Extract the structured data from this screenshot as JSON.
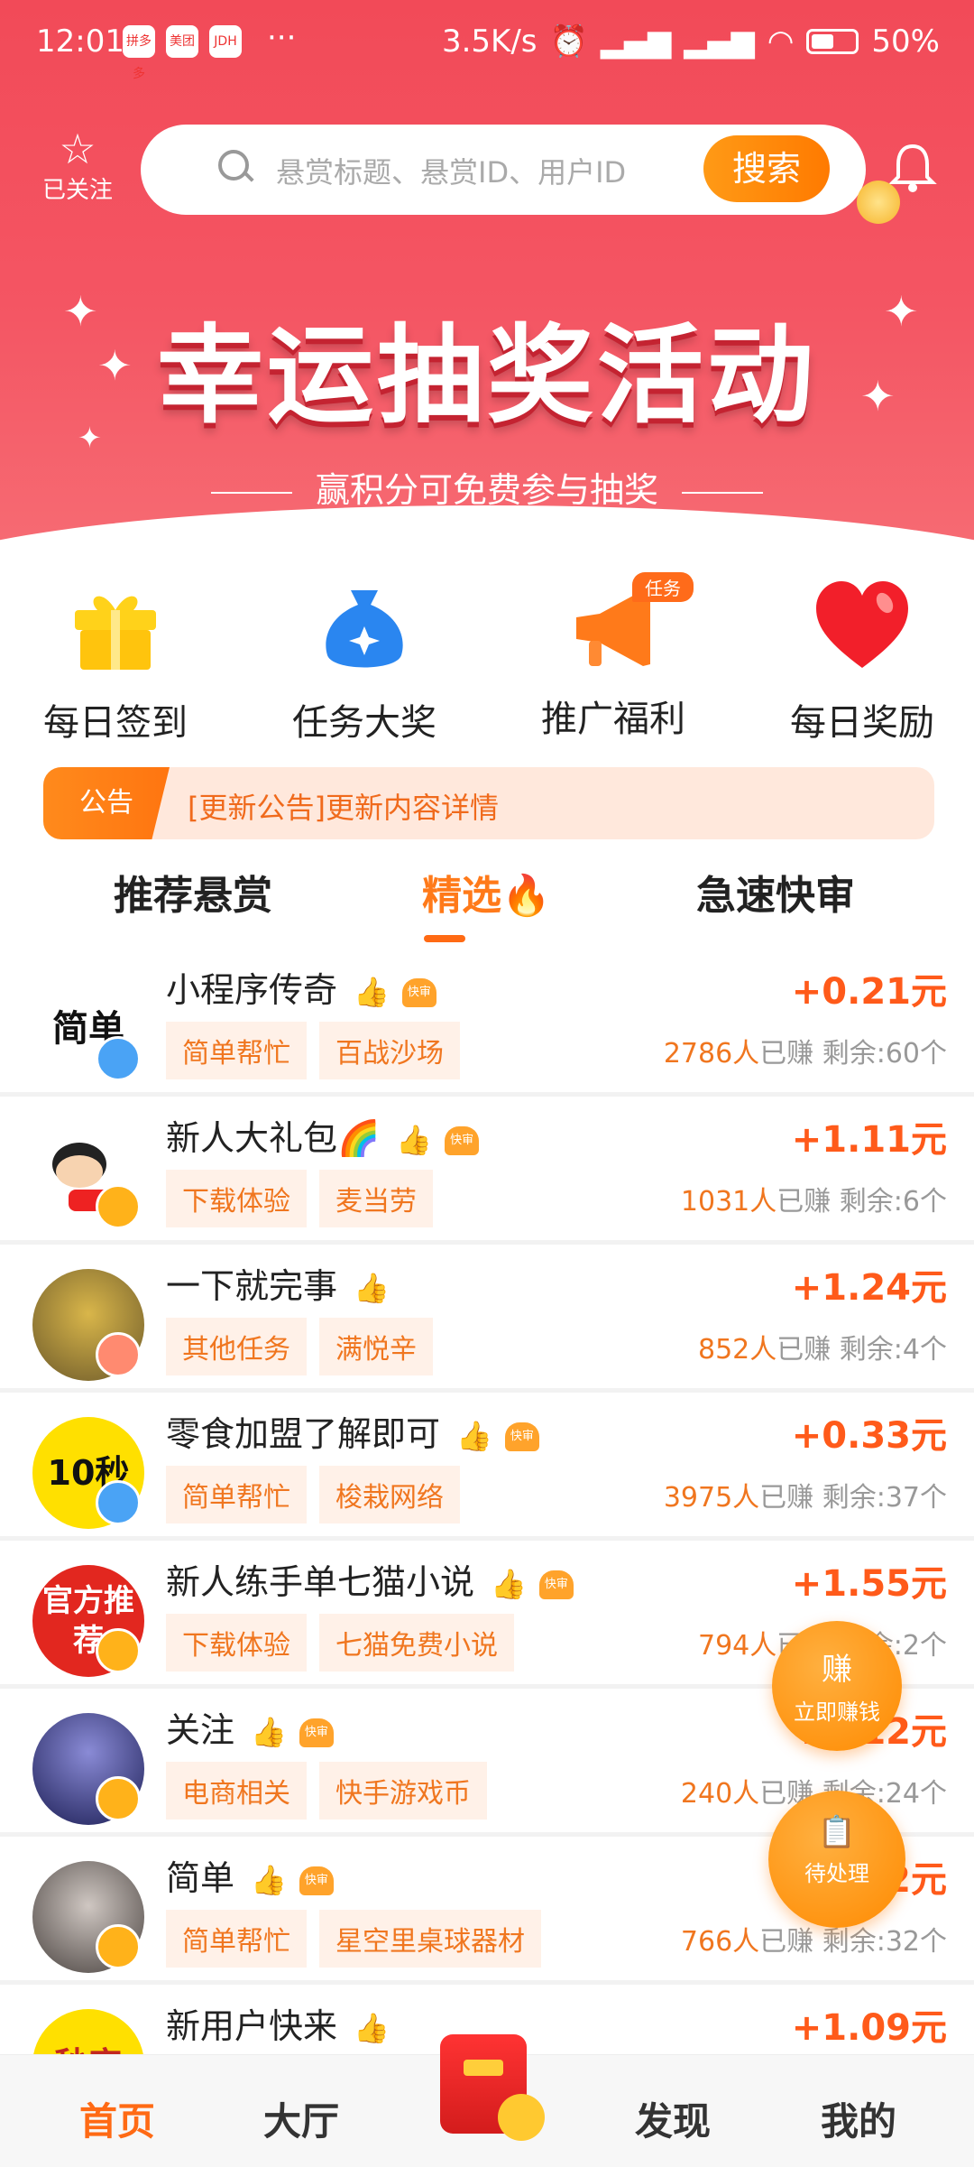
{
  "status_bar": {
    "time": "12:01",
    "speed": "3.5K/s",
    "battery": "50%",
    "app_icons": [
      "拼多多",
      "美团",
      "JDH"
    ],
    "more": "···"
  },
  "header": {
    "follow_label": "已关注",
    "search_placeholder": "悬赏标题、悬赏ID、用户ID",
    "search_button": "搜索",
    "icons": [
      "star-icon",
      "search-icon",
      "bell-icon"
    ]
  },
  "banner": {
    "title": "幸运抽奖活动",
    "subtitle": "赢积分可免费参与抽奖",
    "pages": 5,
    "active_page": 1
  },
  "quick_actions": [
    {
      "label": "每日签到",
      "icon": "gift-icon"
    },
    {
      "label": "任务大奖",
      "icon": "money-bag-icon"
    },
    {
      "label": "推广福利",
      "icon": "megaphone-icon",
      "tag": "任务"
    },
    {
      "label": "每日奖励",
      "icon": "heart-icon"
    }
  ],
  "notice": {
    "label": "公告",
    "text": "[更新公告]更新内容详情"
  },
  "tabs": [
    {
      "label": "推荐悬赏"
    },
    {
      "label": "精选🔥"
    },
    {
      "label": "急速快审"
    }
  ],
  "tasks": [
    {
      "title": "小程序传奇",
      "tags": [
        "简单帮忙",
        "百战沙场"
      ],
      "reward": "+0.21元",
      "count": "2786人",
      "earned": "已赚",
      "remain": "剩余:60个",
      "avatar": "简单"
    },
    {
      "title": "新人大礼包🌈",
      "tags": [
        "下载体验",
        "麦当劳"
      ],
      "reward": "+1.11元",
      "count": "1031人",
      "earned": "已赚",
      "remain": "剩余:6个",
      "avatar": ""
    },
    {
      "title": "一下就完事",
      "tags": [
        "其他任务",
        "满悦辛"
      ],
      "reward": "+1.24元",
      "count": "852人",
      "earned": "已赚",
      "remain": "剩余:4个",
      "avatar": ""
    },
    {
      "title": "零食加盟了解即可",
      "tags": [
        "简单帮忙",
        "梭栽网络"
      ],
      "reward": "+0.33元",
      "count": "3975人",
      "earned": "已赚",
      "remain": "剩余:37个",
      "avatar": "10秒"
    },
    {
      "title": "新人练手单七猫小说",
      "tags": [
        "下载体验",
        "七猫免费小说"
      ],
      "reward": "+1.55元",
      "count": "794人",
      "earned": "已赚",
      "remain": "剩余:2个",
      "avatar": "官方推荐"
    },
    {
      "title": "关注",
      "tags": [
        "电商相关",
        "快手游戏币"
      ],
      "reward": "+0.12元",
      "count": "240人",
      "earned": "已赚",
      "remain": "剩余:24个",
      "avatar": ""
    },
    {
      "title": "简单",
      "tags": [
        "简单帮忙",
        "星空里桌球器材"
      ],
      "reward": "+0.12元",
      "count": "766人",
      "earned": "已赚",
      "remain": "剩余:32个",
      "avatar": ""
    },
    {
      "title": "新用户快来",
      "tags": [],
      "reward": "+1.09元",
      "count": "",
      "earned": "",
      "remain": "",
      "avatar": "秒审"
    }
  ],
  "fabs": {
    "earn": {
      "label": "立即赚钱",
      "glyph": "赚"
    },
    "pending": {
      "label": "待处理"
    }
  },
  "bottom_nav": [
    {
      "label": "首页"
    },
    {
      "label": "大厅"
    },
    {
      "label": "发现"
    },
    {
      "label": "我的"
    }
  ],
  "colors": {
    "brand_orange": "#ff7a1a",
    "header_red": "#f24a58",
    "reward_red": "#ff5a1a"
  }
}
